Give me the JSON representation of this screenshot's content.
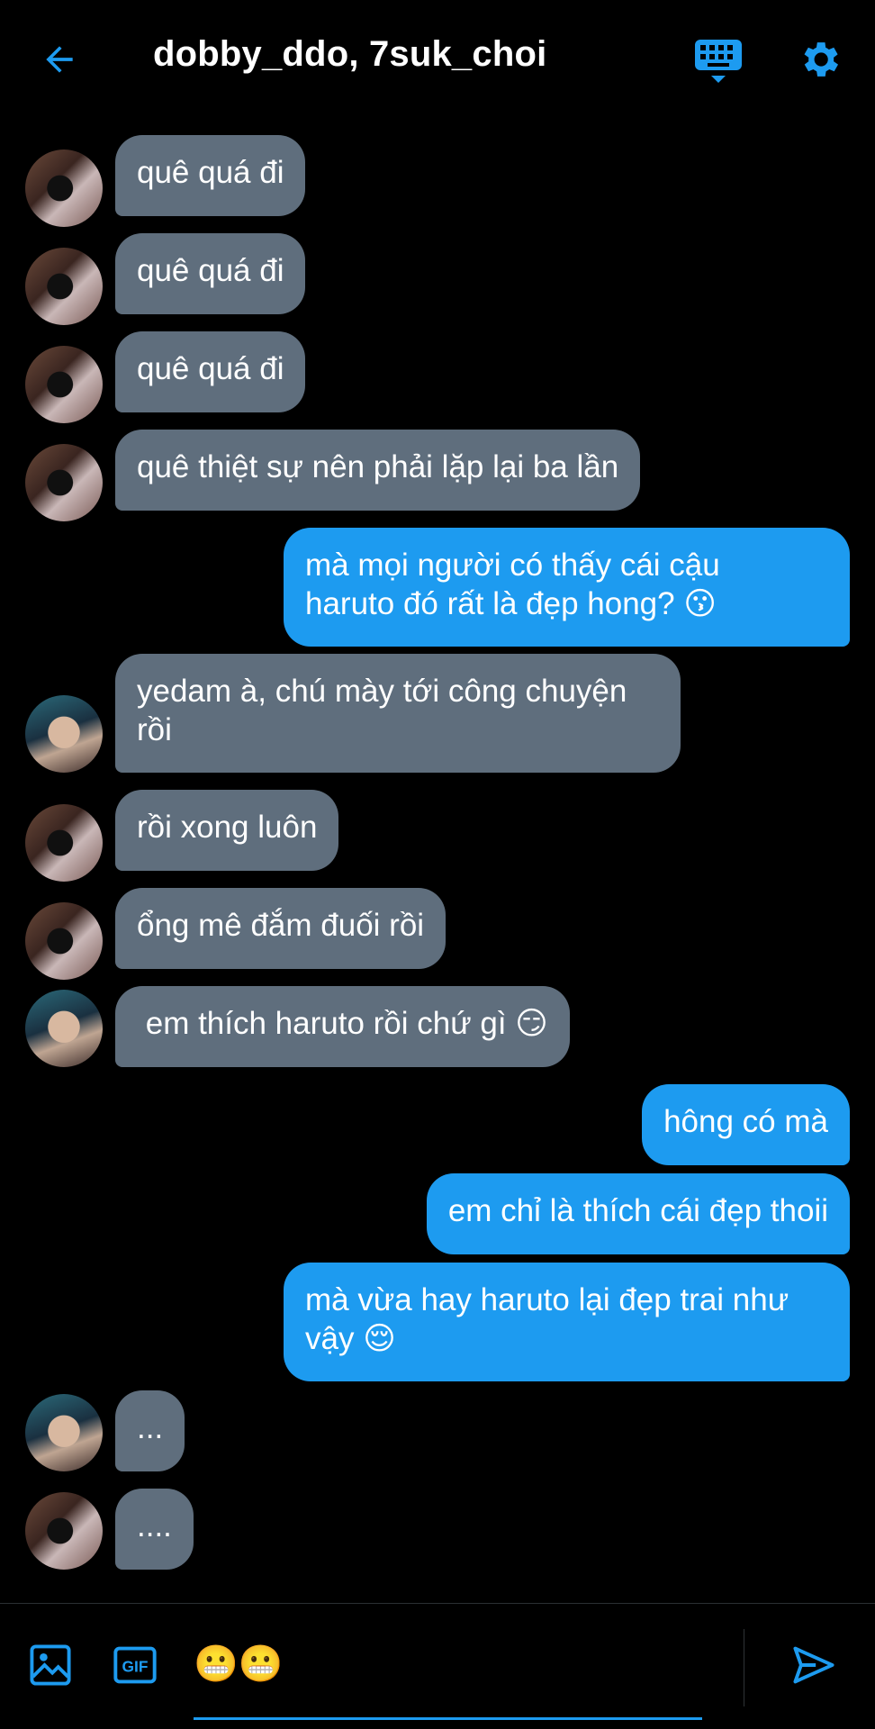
{
  "header": {
    "title": "dobby_ddo, 7suk_choi",
    "back_icon": "arrow-left-icon",
    "keyboard_icon": "keyboard-icon",
    "settings_icon": "gear-icon",
    "accent": "#1d9bf0"
  },
  "messages": [
    {
      "side": "in",
      "avatar": "a1",
      "text": "quê quá đi"
    },
    {
      "side": "in",
      "avatar": "a1",
      "text": "quê quá đi"
    },
    {
      "side": "in",
      "avatar": "a1",
      "text": "quê quá đi"
    },
    {
      "side": "in",
      "avatar": "a1",
      "text": "quê thiệt sự nên phải lặp lại ba lần"
    },
    {
      "side": "out",
      "text": "mà mọi người có thấy cái cậu\nharuto đó rất là đẹp hong? 😗"
    },
    {
      "side": "in",
      "avatar": "a2",
      "text": "yedam à, chú mày tới công chuyện\nrồi"
    },
    {
      "side": "in",
      "avatar": "a1",
      "text": "rồi xong luôn"
    },
    {
      "side": "in",
      "avatar": "a1",
      "text": "ổng mê đắm đuối rồi"
    },
    {
      "side": "in",
      "avatar": "a2",
      "text": " em thích haruto rồi chứ gì 😏"
    },
    {
      "side": "out",
      "text": "hông có mà"
    },
    {
      "side": "out",
      "text": "em chỉ là thích cái đẹp thoii"
    },
    {
      "side": "out",
      "text": "mà vừa hay haruto lại đẹp trai như\nvậy 😌"
    },
    {
      "side": "in",
      "avatar": "a2",
      "text": "..."
    },
    {
      "side": "in",
      "avatar": "a1",
      "text": "...."
    }
  ],
  "composer": {
    "value": "😬😬",
    "image_icon": "image-icon",
    "gif_label": "GIF",
    "send_icon": "send-icon"
  },
  "colors": {
    "incoming_bubble": "#5f6e7d",
    "outgoing_bubble": "#1d9bf0",
    "background": "#000000"
  }
}
